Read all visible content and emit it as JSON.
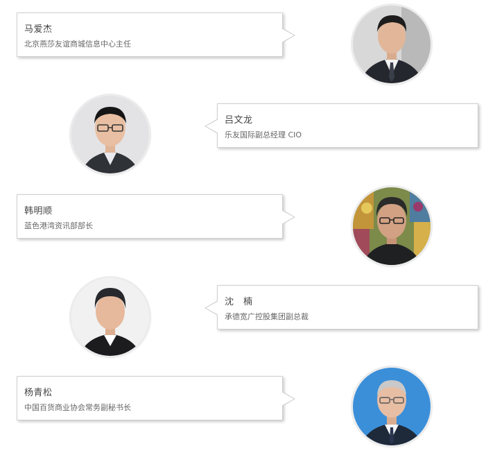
{
  "people": [
    {
      "name": "马爱杰",
      "title": "北京燕莎友谊商城信息中心主任"
    },
    {
      "name": "吕文龙",
      "title": "乐友国际副总经理 CIO"
    },
    {
      "name": "韩明顺",
      "title": "蓝色港湾资讯部部长"
    },
    {
      "name": "沈　楠",
      "title": "承德宽广控股集团副总裁"
    },
    {
      "name": "杨青松",
      "title": "中国百货商业协会常务副秘书长"
    }
  ],
  "colors": {
    "card_border": "#d0d0d0",
    "name_text": "#444444",
    "title_text": "#666666",
    "avatar_bg_gray": "#d9d9d9",
    "avatar_bg_blue": "#3b8fd9"
  }
}
